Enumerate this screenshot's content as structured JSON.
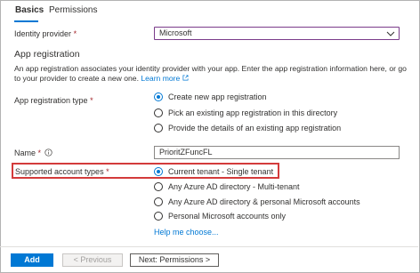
{
  "tabs": [
    {
      "label": "Basics",
      "active": true
    },
    {
      "label": "Permissions",
      "active": false
    }
  ],
  "identity_provider": {
    "label": "Identity provider",
    "required_mark": "*",
    "value": "Microsoft",
    "icon": "chevron-down-icon"
  },
  "app_registration": {
    "heading": "App registration",
    "description": "An app registration associates your identity provider with your app. Enter the app registration information here, or go to your provider to create a new one.",
    "learn_more": "Learn more",
    "type_label": "App registration type",
    "required_mark": "*",
    "options": [
      {
        "label": "Create new app registration",
        "selected": true
      },
      {
        "label": "Pick an existing app registration in this directory",
        "selected": false
      },
      {
        "label": "Provide the details of an existing app registration",
        "selected": false
      }
    ]
  },
  "name_field": {
    "label": "Name",
    "required_mark": "*",
    "value": "PrioritZFuncFL",
    "icon": "info-icon"
  },
  "account_types": {
    "label": "Supported account types",
    "required_mark": "*",
    "options": [
      {
        "label": "Current tenant - Single tenant",
        "selected": true
      },
      {
        "label": "Any Azure AD directory - Multi-tenant",
        "selected": false
      },
      {
        "label": "Any Azure AD directory & personal Microsoft accounts",
        "selected": false
      },
      {
        "label": "Personal Microsoft accounts only",
        "selected": false
      }
    ],
    "help_link": "Help me choose..."
  },
  "footer": {
    "add_label": "Add",
    "previous_label": "< Previous",
    "next_label": "Next: Permissions >"
  },
  "colors": {
    "accent": "#0078d4",
    "required": "#a4262c",
    "highlight_box": "#d33b3b",
    "dropdown_border": "#7a3b8a"
  }
}
